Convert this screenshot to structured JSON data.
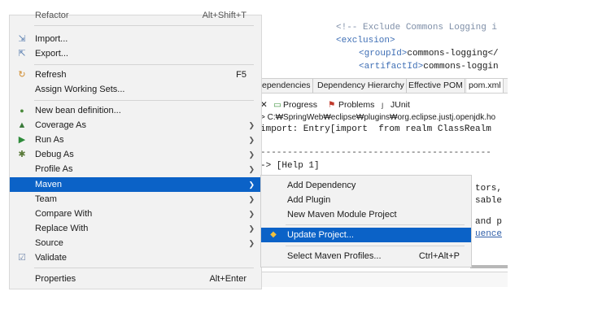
{
  "editor": {
    "lines": [
      {
        "kind": "comment",
        "text": "<!-- Exclude Commons Logging i"
      },
      {
        "kind": "tag",
        "text": "<exclusion>"
      },
      {
        "kind": "mixed",
        "open": "<groupId>",
        "text": "commons-logging</"
      },
      {
        "kind": "mixed",
        "open": "<artifactId>",
        "text": "commons-loggin"
      }
    ]
  },
  "pom_tabs": [
    "ependencies",
    "Dependency Hierarchy",
    "Effective POM",
    "pom.xml"
  ],
  "console": {
    "tabs": [
      "Progress",
      "Problems",
      "JUnit"
    ],
    "path": "> C:₩SpringWeb₩eclipse₩plugins₩org.eclipse.justj.openjdk.ho",
    "line1": "import: Entry[import  from realm ClassRealm",
    "dashes": "-------------------------------------------",
    "help": "-> [Help 1]",
    "frag1": "tors, ",
    "frag2": "sable ",
    "frag3": "and p",
    "frag4": "uence"
  },
  "context_menu": {
    "top_partial": "Refactor",
    "top_partial_shortcut": "Alt+Shift+T",
    "items": [
      {
        "label": "Import...",
        "icon": "import-icon"
      },
      {
        "label": "Export...",
        "icon": "export-icon"
      },
      {
        "label": "Refresh",
        "shortcut": "F5",
        "icon": "refresh-icon"
      },
      {
        "label": "Assign Working Sets...",
        "icon": ""
      },
      {
        "label": "New bean definition...",
        "icon": "bean-icon"
      },
      {
        "label": "Coverage As",
        "icon": "coverage-icon",
        "submenu": true
      },
      {
        "label": "Run As",
        "icon": "run-icon",
        "submenu": true
      },
      {
        "label": "Debug As",
        "icon": "debug-icon",
        "submenu": true
      },
      {
        "label": "Profile As",
        "icon": "",
        "submenu": true
      },
      {
        "label": "Maven",
        "icon": "",
        "submenu": true,
        "selected": true
      },
      {
        "label": "Team",
        "icon": "",
        "submenu": true
      },
      {
        "label": "Compare With",
        "icon": "",
        "submenu": true
      },
      {
        "label": "Replace With",
        "icon": "",
        "submenu": true
      },
      {
        "label": "Source",
        "icon": "",
        "submenu": true
      },
      {
        "label": "Validate",
        "icon": "checkbox-icon"
      },
      {
        "label": "Properties",
        "shortcut": "Alt+Enter",
        "icon": ""
      }
    ]
  },
  "maven_submenu": {
    "items": [
      {
        "label": "Add Dependency"
      },
      {
        "label": "Add Plugin"
      },
      {
        "label": "New Maven Module Project"
      },
      {
        "label": "Update Project...",
        "selected": true,
        "icon": "maven-update-icon"
      },
      {
        "label": "Select Maven Profiles...",
        "shortcut": "Ctrl+Alt+P"
      }
    ]
  },
  "colors": {
    "selection": "#0b62c7",
    "menu_bg": "#f2f2f2",
    "comment": "#7f8fa8",
    "tag": "#3f6fb5"
  }
}
